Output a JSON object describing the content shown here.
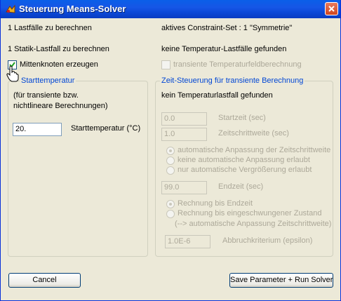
{
  "window": {
    "title": "Steuerung Means-Solver"
  },
  "left": {
    "load_cases": "1 Lastfälle zu berechnen",
    "static_load_cases": "1 Statik-Lastfall zu berechnen",
    "midnodes_label": "Mittenknoten erzeugen",
    "midnodes_checked": true,
    "start_temp_group": {
      "legend": "Starttemperatur",
      "note_line1": "(für transiente bzw.",
      "note_line2": "nichtlineare Berechnungen)",
      "value": "20.",
      "label": "Starttemperatur (°C)"
    }
  },
  "right": {
    "constraint_set": "aktives Constraint-Set : 1 \"Symmetrie\"",
    "no_temp_cases": "keine Temperatur-Lastfälle gefunden",
    "transient_label": "transiente Temperaturfeldberechnung",
    "time_group": {
      "legend": "Zeit-Steuerung für transiente Berechnung",
      "no_temp_case": "kein Temperaturlastfall gefunden",
      "start_time_value": "0.0",
      "start_time_label": "Startzeit (sec)",
      "step_value": "1.0",
      "step_label": "Zeitschrittweite (sec)",
      "radio_auto": "automatische Anpassung der Zeitschrittweite",
      "radio_none": "keine automatische Anpassung erlaubt",
      "radio_grow": "nur automatische Vergrößerung erlaubt",
      "end_time_value": "99.0",
      "end_time_label": "Endzeit (sec)",
      "radio_until_end": "Rechnung bis Endzeit",
      "radio_steady": "Rechnung bis eingeschwungener Zustand",
      "steady_note": "(--> automatische Anpassung Zeitschrittweite)",
      "epsilon_value": "1.0E-6",
      "epsilon_label": "Abbruchkriterium (epsilon)"
    }
  },
  "buttons": {
    "cancel": "Cancel",
    "run": "Save Parameter + Run Solver"
  }
}
